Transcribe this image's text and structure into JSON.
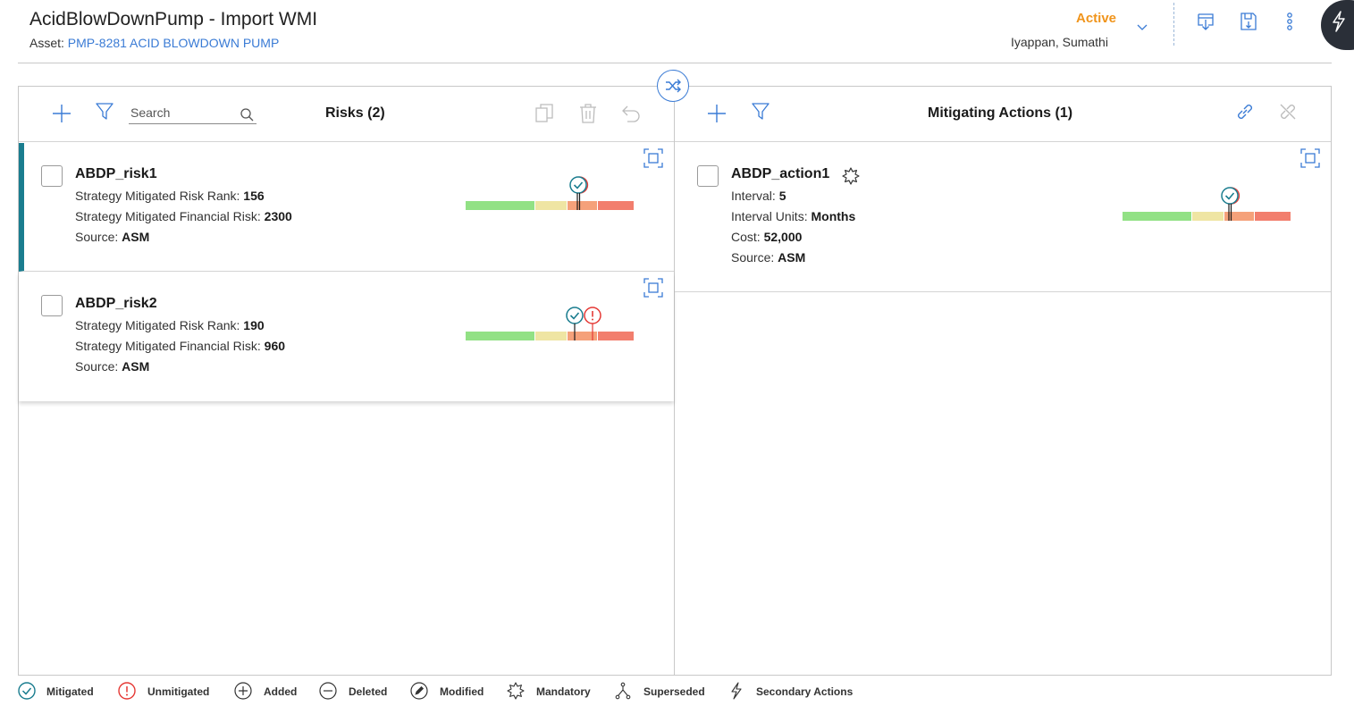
{
  "header": {
    "title": "AcidBlowDownPump - Import WMI",
    "asset_label": "Asset:",
    "asset_value": "PMP-8281 ACID BLOWDOWN PUMP",
    "status": "Active",
    "user": "Iyappan, Sumathi"
  },
  "risks_panel": {
    "title": "Risks (2)",
    "search_placeholder": "Search",
    "cards": [
      {
        "name": "ABDP_risk1",
        "fields": [
          {
            "label": "Strategy Mitigated Risk Rank:",
            "value": "156"
          },
          {
            "label": "Strategy Mitigated Financial Risk:",
            "value": "2300"
          },
          {
            "label": "Source:",
            "value": "ASM"
          }
        ],
        "markers": [
          "mitigated"
        ]
      },
      {
        "name": "ABDP_risk2",
        "fields": [
          {
            "label": "Strategy Mitigated Risk Rank:",
            "value": "190"
          },
          {
            "label": "Strategy Mitigated Financial Risk:",
            "value": "960"
          },
          {
            "label": "Source:",
            "value": "ASM"
          }
        ],
        "markers": [
          "mitigated",
          "unmitigated"
        ]
      }
    ]
  },
  "actions_panel": {
    "title": "Mitigating Actions (1)",
    "cards": [
      {
        "name": "ABDP_action1",
        "icon": "mandatory-icon",
        "fields": [
          {
            "label": "Interval:",
            "value": "5"
          },
          {
            "label": "Interval Units:",
            "value": "Months"
          },
          {
            "label": "Cost:",
            "value": "52,000"
          },
          {
            "label": "Source:",
            "value": "ASM"
          }
        ],
        "markers": [
          "mitigated"
        ]
      }
    ]
  },
  "legend": [
    {
      "icon": "mitigated-icon",
      "label": "Mitigated"
    },
    {
      "icon": "unmitigated-icon",
      "label": "Unmitigated"
    },
    {
      "icon": "added-icon",
      "label": "Added"
    },
    {
      "icon": "deleted-icon",
      "label": "Deleted"
    },
    {
      "icon": "modified-icon",
      "label": "Modified"
    },
    {
      "icon": "mandatory-icon",
      "label": "Mandatory"
    },
    {
      "icon": "superseded-icon",
      "label": "Superseded"
    },
    {
      "icon": "secondary-actions-icon",
      "label": "Secondary Actions"
    }
  ],
  "colors": {
    "accent": "#3a7bd5",
    "status": "#f0941b",
    "selected_bar": "#1a7d8f",
    "mitigated": "#1a7d8f",
    "unmitigated": "#e53935",
    "risk_low": "#92e185",
    "risk_medium": "#efe5a3",
    "risk_high": "#f5a17a",
    "risk_critical": "#f27e6d"
  }
}
